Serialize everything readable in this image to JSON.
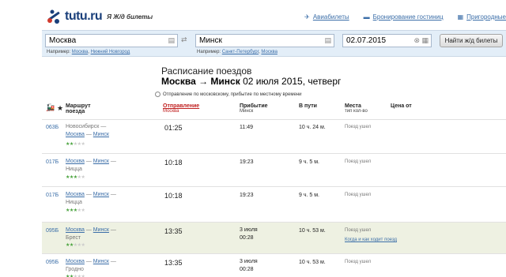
{
  "header": {
    "logo_text": "tutu.ru",
    "logo_sub": "Я Ж/д билеты",
    "nav": [
      {
        "icon": "✈",
        "label": "Авиабилеты"
      },
      {
        "icon": "▬",
        "label": "Бронирование гостиниц"
      },
      {
        "icon": "▦",
        "label": "Пригородные"
      }
    ]
  },
  "search": {
    "from_value": "Москва",
    "to_value": "Минск",
    "date_value": "02.07.2015",
    "swap_icon": "⇄",
    "hint_prefix": "Например:",
    "from_hints": [
      "Москва",
      "Нижний Новгород"
    ],
    "to_hints": [
      "Санкт-Петербург",
      "Москва"
    ],
    "button_label": "Найти ж/д билеты"
  },
  "page": {
    "title": "Расписание поездов",
    "route": "Москва → Минск",
    "date_text": "02 июля 2015, четверг",
    "timezone": "Отправление по московскому, прибытие по местному времени"
  },
  "columns": {
    "route": "Маршрут",
    "route_sub": "поезда",
    "dep": "Отправление",
    "dep_sub": "Москва",
    "arr": "Прибытие",
    "arr_sub": "Минск",
    "way": "В пути",
    "seats": "Места",
    "seats_sub": "тип кол-во",
    "price": "Цена от"
  },
  "rows": [
    {
      "num": "063Б",
      "route_a": "Новосибирск —",
      "route_b_link": "Москва",
      "route_c_link": "Минск",
      "route_c_suffix": "",
      "route_d": "",
      "stars": 2,
      "dep": "01:25",
      "arr_day": "",
      "arr": "11:49",
      "way": "10 ч. 24 м.",
      "seats": "Поезд ушел",
      "extra": ""
    },
    {
      "num": "017Б",
      "route_a": "",
      "route_b_link": "Москва",
      "route_c_link": "Минск",
      "route_c_suffix": " —",
      "route_d": "Ницца",
      "stars": 3,
      "dep": "10:18",
      "arr_day": "",
      "arr": "19:23",
      "way": "9 ч. 5 м.",
      "seats": "Поезд ушел",
      "extra": ""
    },
    {
      "num": "017Б",
      "route_a": "",
      "route_b_link": "Москва",
      "route_c_link": "Минск",
      "route_c_suffix": " —",
      "route_d": "Ницца",
      "stars": 3,
      "dep": "10:18",
      "arr_day": "",
      "arr": "19:23",
      "way": "9 ч. 5 м.",
      "seats": "Поезд ушел",
      "extra": ""
    },
    {
      "num": "095Б",
      "route_a": "",
      "route_b_link": "Москва",
      "route_c_link": "Минск",
      "route_c_suffix": " —",
      "route_d": "Брест",
      "stars": 2,
      "dep": "13:35",
      "arr_day": "3 июля",
      "arr": "00:28",
      "way": "10 ч. 53 м.",
      "seats": "Поезд ушел",
      "extra": "Когда и как ходит поезд"
    },
    {
      "num": "095Б",
      "route_a": "",
      "route_b_link": "Москва",
      "route_c_link": "Минск",
      "route_c_suffix": " —",
      "route_d": "Гродно",
      "stars": 2,
      "dep": "13:35",
      "arr_day": "3 июля",
      "arr": "00:28",
      "way": "10 ч. 53 м.",
      "seats": "Поезд ушел",
      "extra": ""
    }
  ]
}
